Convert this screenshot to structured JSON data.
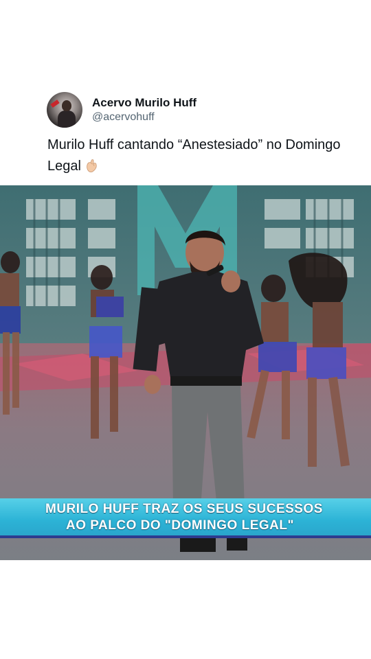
{
  "tweet": {
    "author": {
      "display_name": "Acervo Murilo Huff",
      "handle": "@acervohuff",
      "avatar_icon": "profile-avatar"
    },
    "text": "Murilo Huff cantando “Anestesiado” no Domingo Legal",
    "emoji_icon": "pinching-hand-emoji"
  },
  "video": {
    "caption_line_1": "MURILO HUFF TRAZ OS SEUS SUCESSOS",
    "caption_line_2": "AO PALCO DO \"DOMINGO LEGAL\"",
    "caption_color": "#2cb3d6",
    "caption_border_color": "#2d3b8f"
  }
}
